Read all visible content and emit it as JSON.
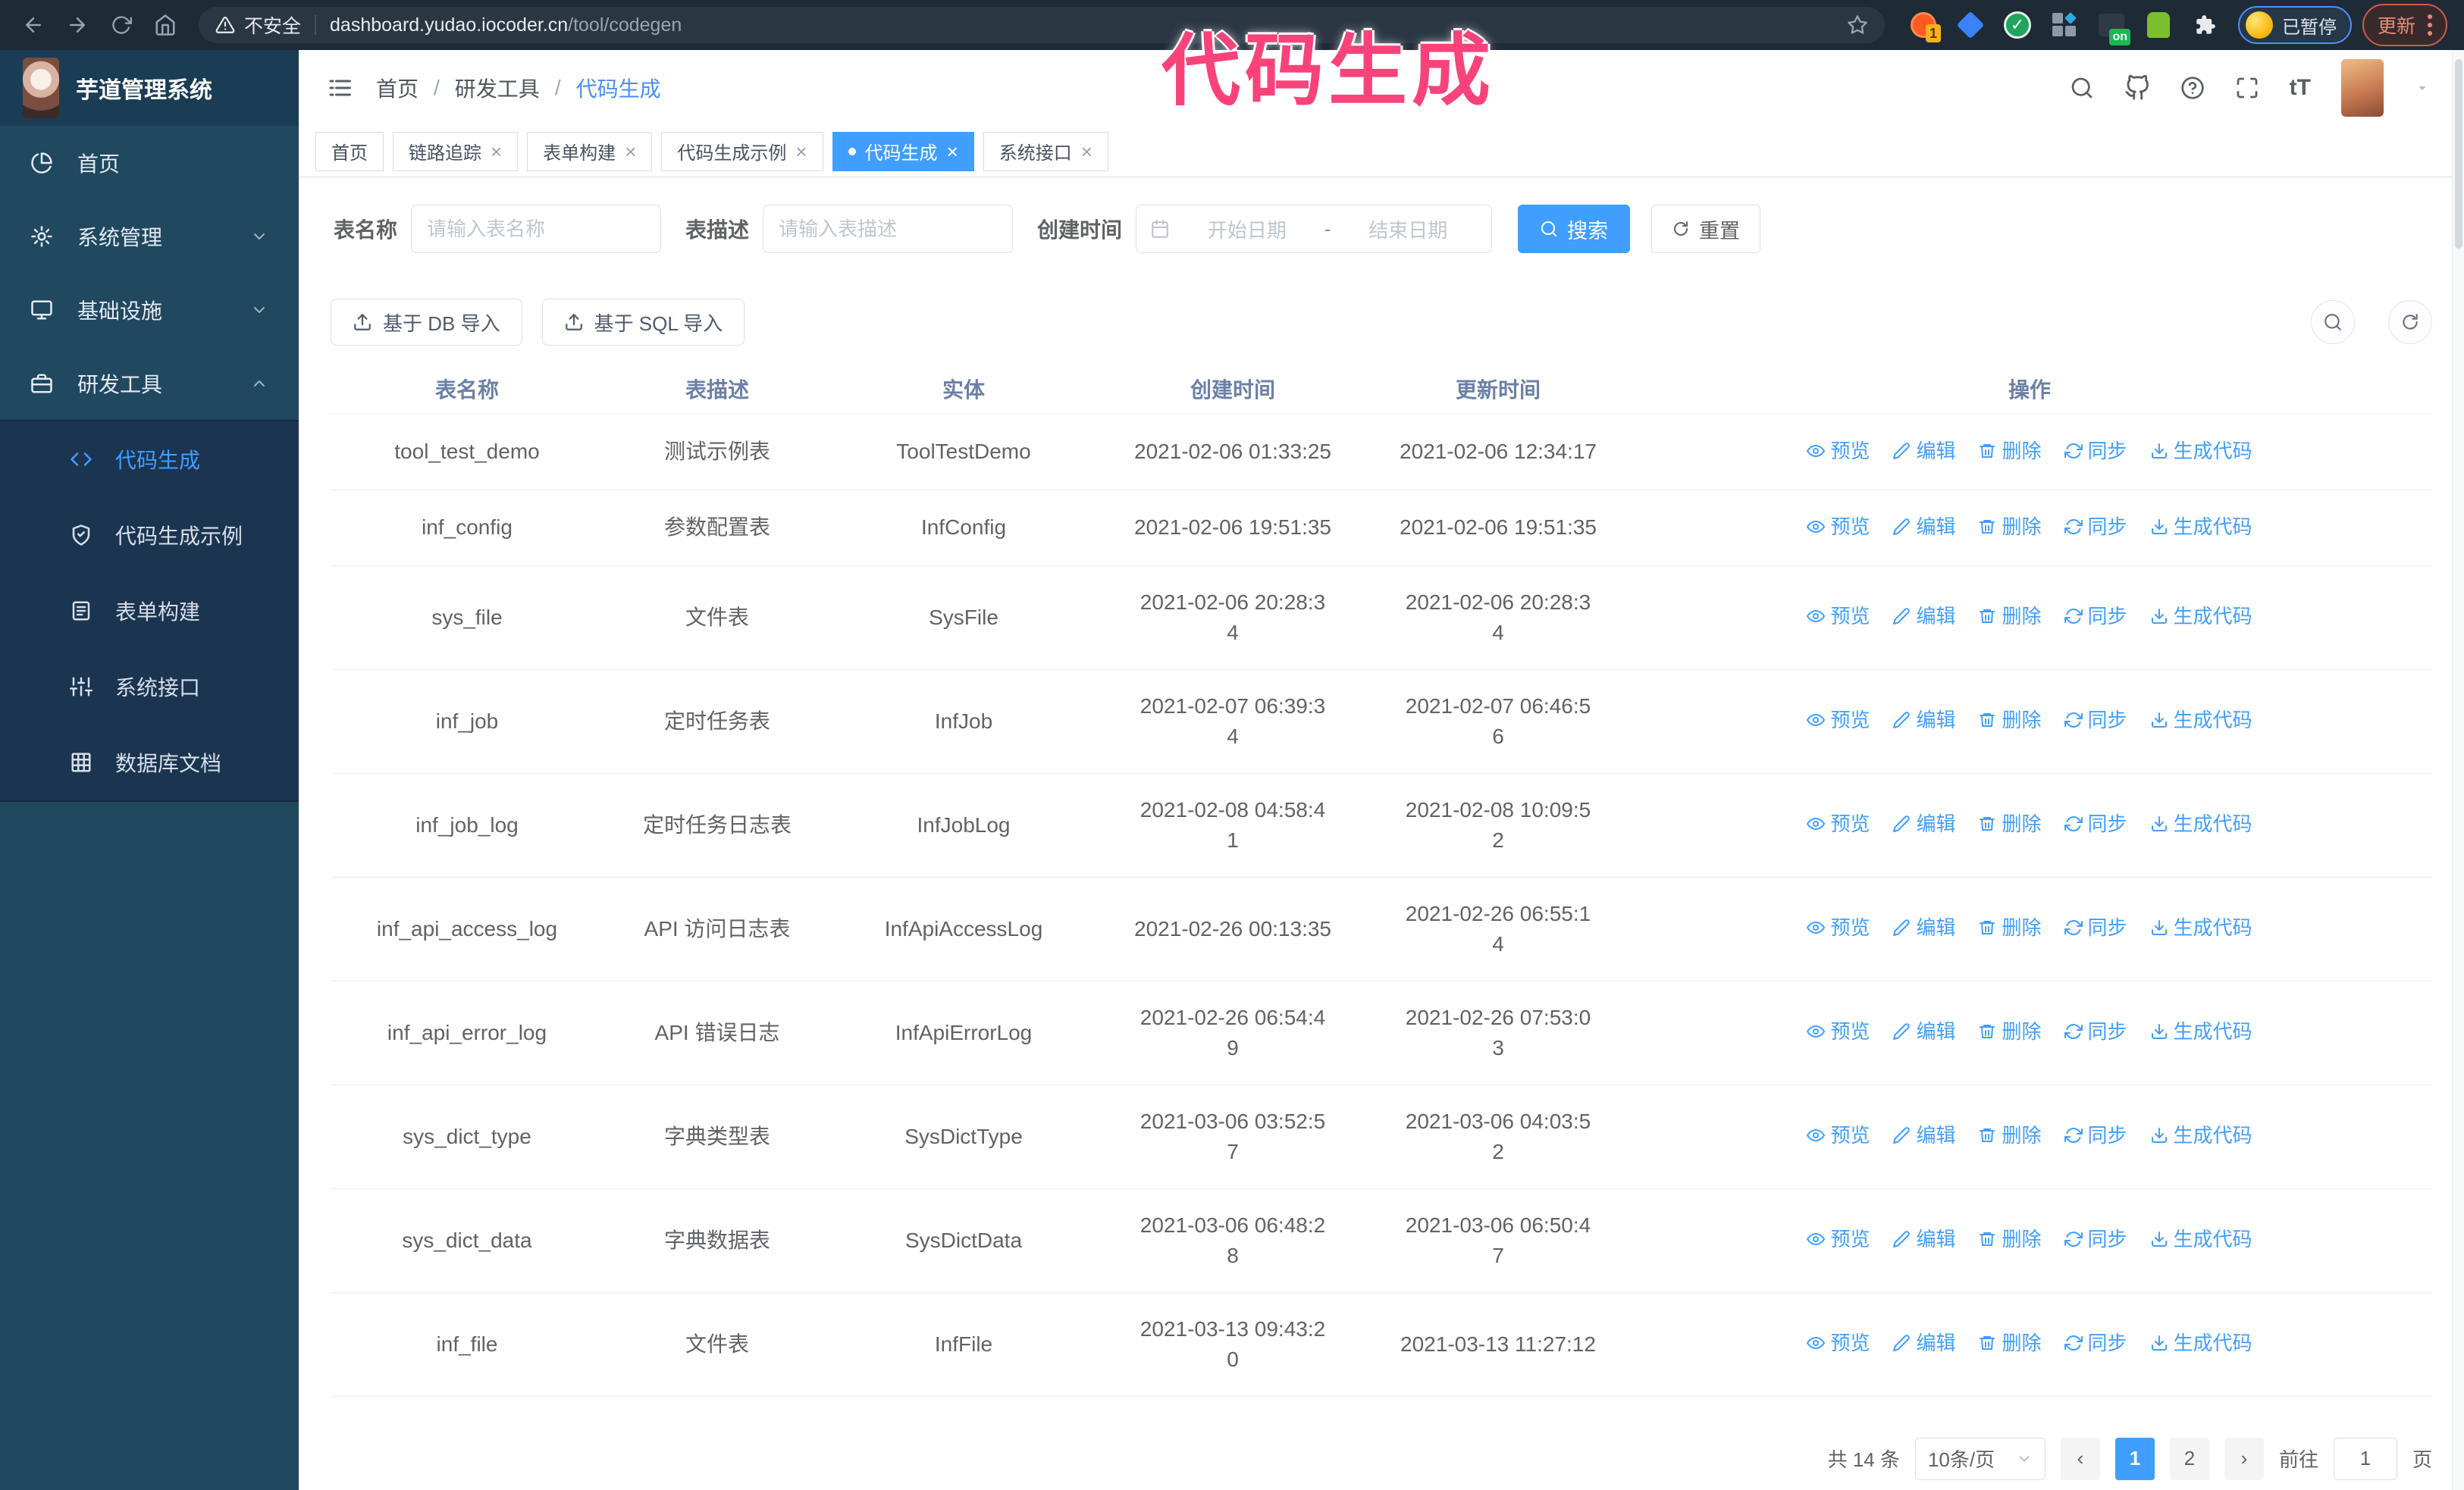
{
  "browser": {
    "security": "不安全",
    "url_host": "dashboard.yudao.iocoder.cn",
    "url_path": "/tool/codegen",
    "ext_badge": "1",
    "ext_on": "on",
    "paused": "已暂停",
    "update": "更新"
  },
  "annotation": "代码生成",
  "sidebar": {
    "title": "芋道管理系统",
    "items": [
      {
        "label": "首页"
      },
      {
        "label": "系统管理"
      },
      {
        "label": "基础设施"
      },
      {
        "label": "研发工具"
      }
    ],
    "submenu": [
      {
        "label": "代码生成"
      },
      {
        "label": "代码生成示例"
      },
      {
        "label": "表单构建"
      },
      {
        "label": "系统接口"
      },
      {
        "label": "数据库文档"
      }
    ]
  },
  "breadcrumb": {
    "items": [
      "首页",
      "研发工具",
      "代码生成"
    ],
    "separator": "/"
  },
  "header_icons": {
    "font_size": "tT"
  },
  "tabs": [
    {
      "label": "首页"
    },
    {
      "label": "链路追踪"
    },
    {
      "label": "表单构建"
    },
    {
      "label": "代码生成示例"
    },
    {
      "label": "代码生成"
    },
    {
      "label": "系统接口"
    }
  ],
  "filters": {
    "name_label": "表名称",
    "name_placeholder": "请输入表名称",
    "desc_label": "表描述",
    "desc_placeholder": "请输入表描述",
    "time_label": "创建时间",
    "start_placeholder": "开始日期",
    "range_separator": "-",
    "end_placeholder": "结束日期",
    "search": "搜索",
    "reset": "重置"
  },
  "toolbar": {
    "import_db": "基于 DB 导入",
    "import_sql": "基于 SQL 导入"
  },
  "table": {
    "columns": [
      "表名称",
      "表描述",
      "实体",
      "创建时间",
      "更新时间",
      "操作"
    ],
    "row_actions": [
      "预览",
      "编辑",
      "删除",
      "同步",
      "生成代码"
    ],
    "rows": [
      {
        "name": "tool_test_demo",
        "desc": "测试示例表",
        "entity": "ToolTestDemo",
        "created": "2021-02-06 01:33:25",
        "updated": "2021-02-06 12:34:17"
      },
      {
        "name": "inf_config",
        "desc": "参数配置表",
        "entity": "InfConfig",
        "created": "2021-02-06 19:51:35",
        "updated": "2021-02-06 19:51:35"
      },
      {
        "name": "sys_file",
        "desc": "文件表",
        "entity": "SysFile",
        "created": "2021-02-06 20:28:3\n4",
        "updated": "2021-02-06 20:28:3\n4"
      },
      {
        "name": "inf_job",
        "desc": "定时任务表",
        "entity": "InfJob",
        "created": "2021-02-07 06:39:3\n4",
        "updated": "2021-02-07 06:46:5\n6"
      },
      {
        "name": "inf_job_log",
        "desc": "定时任务日志表",
        "entity": "InfJobLog",
        "created": "2021-02-08 04:58:4\n1",
        "updated": "2021-02-08 10:09:5\n2"
      },
      {
        "name": "inf_api_access_log",
        "desc": "API 访问日志表",
        "entity": "InfApiAccessLog",
        "created": "2021-02-26 00:13:35",
        "updated": "2021-02-26 06:55:1\n4"
      },
      {
        "name": "inf_api_error_log",
        "desc": "API 错误日志",
        "entity": "InfApiErrorLog",
        "created": "2021-02-26 06:54:4\n9",
        "updated": "2021-02-26 07:53:0\n3"
      },
      {
        "name": "sys_dict_type",
        "desc": "字典类型表",
        "entity": "SysDictType",
        "created": "2021-03-06 03:52:5\n7",
        "updated": "2021-03-06 04:03:5\n2"
      },
      {
        "name": "sys_dict_data",
        "desc": "字典数据表",
        "entity": "SysDictData",
        "created": "2021-03-06 06:48:2\n8",
        "updated": "2021-03-06 06:50:4\n7"
      },
      {
        "name": "inf_file",
        "desc": "文件表",
        "entity": "InfFile",
        "created": "2021-03-13 09:43:2\n0",
        "updated": "2021-03-13 11:27:12"
      }
    ]
  },
  "pagination": {
    "total": "共 14 条",
    "page_size": "10条/页",
    "pages": [
      "1",
      "2"
    ],
    "goto_label": "前往",
    "goto_value": "1",
    "unit_label": "页"
  },
  "colors": {
    "primary": "#409eff",
    "annotation": "#f8437a"
  }
}
